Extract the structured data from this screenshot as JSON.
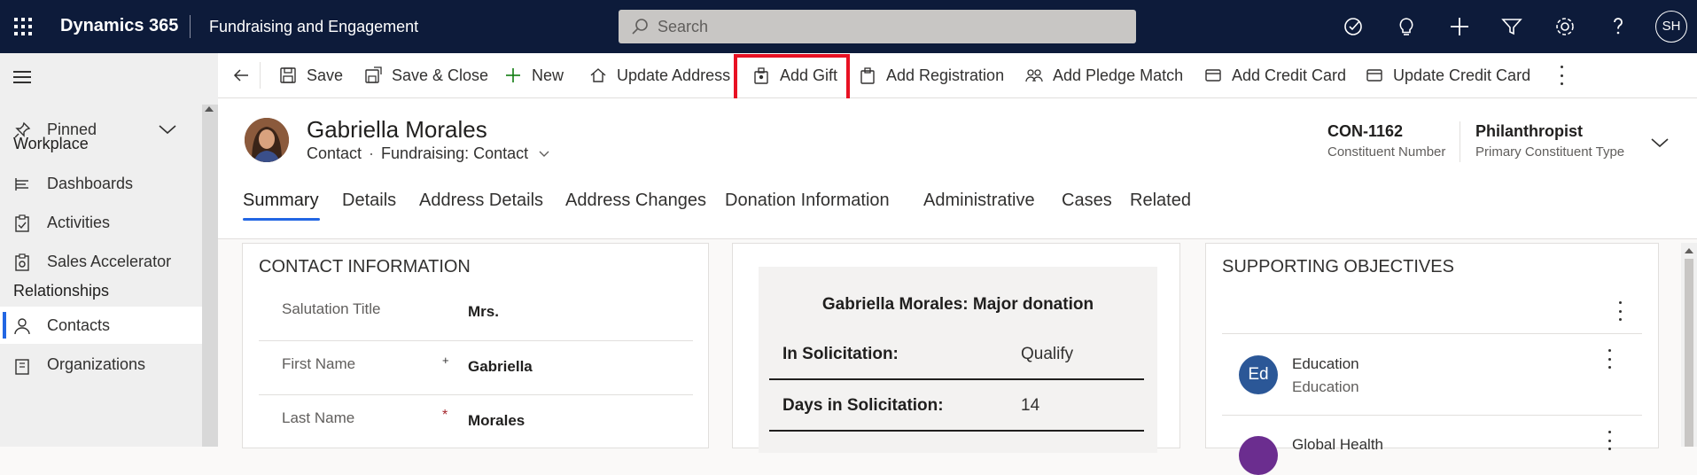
{
  "topbar": {
    "brand": "Dynamics 365",
    "app": "Fundraising and Engagement",
    "search_placeholder": "Search",
    "user_initials": "SH"
  },
  "sidebar": {
    "pinned": "Pinned",
    "workplace": "Workplace",
    "items_workplace": [
      "Dashboards",
      "Activities",
      "Sales Accelerator"
    ],
    "relationships": "Relationships",
    "items_rel": [
      "Contacts",
      "Organizations"
    ]
  },
  "commands": [
    "Save",
    "Save & Close",
    "New",
    "Update Address",
    "Add Gift",
    "Add Registration",
    "Add Pledge Match",
    "Add Credit Card",
    "Update Credit Card"
  ],
  "record": {
    "name": "Gabriella Morales",
    "entity": "Contact",
    "form": "Fundraising: Contact",
    "fields": [
      {
        "value": "CON-1162",
        "label": "Constituent Number"
      },
      {
        "value": "Philanthropist",
        "label": "Primary Constituent Type"
      }
    ]
  },
  "tabs": [
    "Summary",
    "Details",
    "Address Details",
    "Address Changes",
    "Donation Information",
    "Administrative",
    "Cases",
    "Related"
  ],
  "contact_info": {
    "title": "CONTACT INFORMATION",
    "rows": [
      {
        "label": "Salutation Title",
        "value": "Mrs.",
        "required": ""
      },
      {
        "label": "First Name",
        "value": "Gabriella",
        "required": "+"
      },
      {
        "label": "Last Name",
        "value": "Morales",
        "required": "*"
      }
    ]
  },
  "bpf": {
    "title": "Gabriella Morales: Major donation",
    "rows": [
      {
        "key": "In Solicitation:",
        "value": "Qualify"
      },
      {
        "key": "Days in Solicitation:",
        "value": "14"
      }
    ]
  },
  "objectives": {
    "title": "SUPPORTING OBJECTIVES",
    "items": [
      {
        "initials": "Ed",
        "name": "Education",
        "sub": "Education",
        "color": "#2b5797"
      },
      {
        "initials": "",
        "name": "Global Health",
        "sub": "",
        "color": "#6b2d8f"
      }
    ]
  }
}
